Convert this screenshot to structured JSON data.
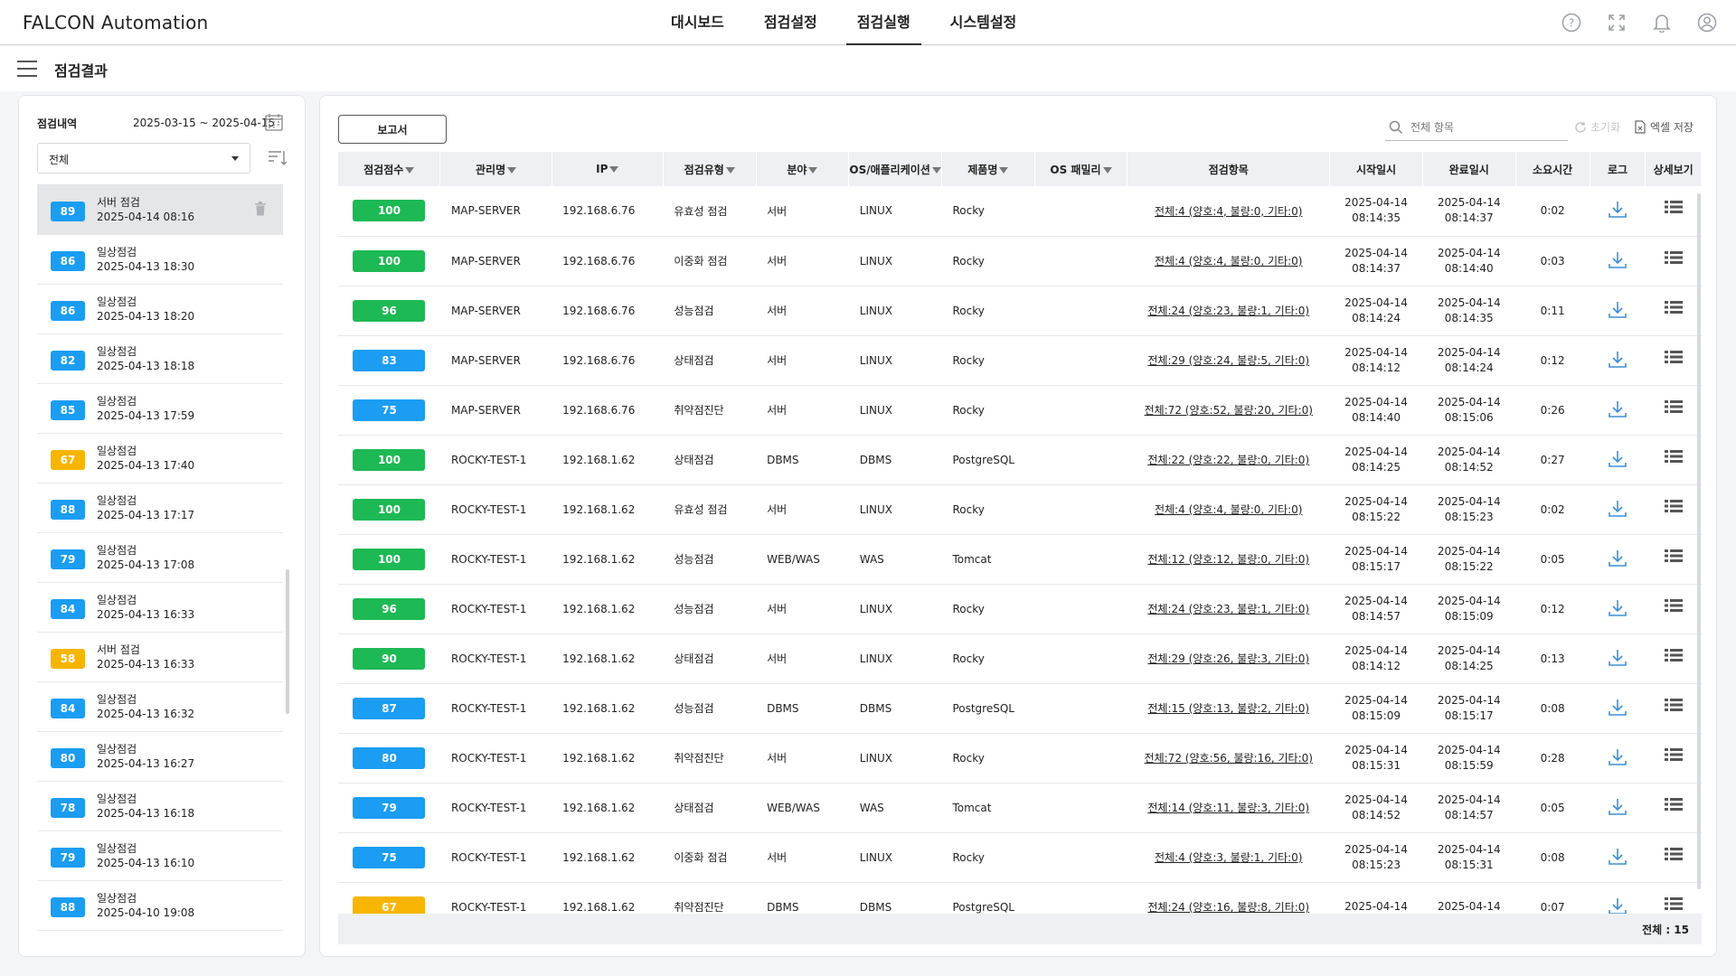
{
  "app_title": "FALCON Automation",
  "nav": [
    "대시보드",
    "점검설정",
    "점검실행",
    "시스템설정"
  ],
  "nav_active": 2,
  "top_icons": [
    "help-icon",
    "fullscreen-icon",
    "bell-icon",
    "user-icon"
  ],
  "page_title": "점검결과",
  "left": {
    "label": "점검내역",
    "date_range": "2025-03-15 ~ 2025-04-15",
    "filter_value": "전체",
    "items": [
      {
        "score": "89",
        "type": "서버 점검",
        "date": "2025-04-14 08:16",
        "color": "#1a9df2",
        "selected": true
      },
      {
        "score": "86",
        "type": "일상점검",
        "date": "2025-04-13 18:30",
        "color": "#1a9df2"
      },
      {
        "score": "86",
        "type": "일상점검",
        "date": "2025-04-13 18:20",
        "color": "#1a9df2"
      },
      {
        "score": "82",
        "type": "일상점검",
        "date": "2025-04-13 18:18",
        "color": "#1a9df2"
      },
      {
        "score": "85",
        "type": "일상점검",
        "date": "2025-04-13 17:59",
        "color": "#1a9df2"
      },
      {
        "score": "67",
        "type": "일상점검",
        "date": "2025-04-13 17:40",
        "color": "#f7b500"
      },
      {
        "score": "88",
        "type": "일상점검",
        "date": "2025-04-13 17:17",
        "color": "#1a9df2"
      },
      {
        "score": "79",
        "type": "일상점검",
        "date": "2025-04-13 17:08",
        "color": "#1a9df2"
      },
      {
        "score": "84",
        "type": "일상점검",
        "date": "2025-04-13 16:33",
        "color": "#1a9df2"
      },
      {
        "score": "58",
        "type": "서버 점검",
        "date": "2025-04-13 16:33",
        "color": "#f7b500"
      },
      {
        "score": "84",
        "type": "일상점검",
        "date": "2025-04-13 16:32",
        "color": "#1a9df2"
      },
      {
        "score": "80",
        "type": "일상점검",
        "date": "2025-04-13 16:27",
        "color": "#1a9df2"
      },
      {
        "score": "78",
        "type": "일상점검",
        "date": "2025-04-13 16:18",
        "color": "#1a9df2"
      },
      {
        "score": "79",
        "type": "일상점검",
        "date": "2025-04-13 16:10",
        "color": "#1a9df2"
      },
      {
        "score": "88",
        "type": "일상점검",
        "date": "2025-04-10 19:08",
        "color": "#1a9df2"
      }
    ]
  },
  "main": {
    "report_button": "보고서",
    "search_placeholder": "전체 항목",
    "reset_label": "초기화",
    "excel_label": "엑셀 저장",
    "columns": [
      "점검점수",
      "관리명",
      "IP",
      "점검유형",
      "분야",
      "OS/애플리케이션",
      "제품명",
      "OS 패밀리",
      "점검항목",
      "시작일시",
      "완료일시",
      "소요시간",
      "로그",
      "상세보기"
    ],
    "filterable": [
      true,
      true,
      true,
      true,
      true,
      true,
      true,
      true,
      false,
      false,
      false,
      false,
      false,
      false
    ],
    "rows": [
      {
        "score": "100",
        "color": "#1db954",
        "name": "MAP-SERVER",
        "ip": "192.168.6.76",
        "type": "유효성 점검",
        "field": "서버",
        "os": "LINUX",
        "product": "Rocky",
        "family": "",
        "items": "전체:4 (양호:4, 불량:0, 기타:0)",
        "start_d": "2025-04-14",
        "start_t": "08:14:35",
        "end_d": "2025-04-14",
        "end_t": "08:14:37",
        "dur": "0:02"
      },
      {
        "score": "100",
        "color": "#1db954",
        "name": "MAP-SERVER",
        "ip": "192.168.6.76",
        "type": "이중화 점검",
        "field": "서버",
        "os": "LINUX",
        "product": "Rocky",
        "family": "",
        "items": "전체:4 (양호:4, 불량:0, 기타:0)",
        "start_d": "2025-04-14",
        "start_t": "08:14:37",
        "end_d": "2025-04-14",
        "end_t": "08:14:40",
        "dur": "0:03"
      },
      {
        "score": "96",
        "color": "#1db954",
        "name": "MAP-SERVER",
        "ip": "192.168.6.76",
        "type": "성능점검",
        "field": "서버",
        "os": "LINUX",
        "product": "Rocky",
        "family": "",
        "items": "전체:24 (양호:23, 불량:1, 기타:0)",
        "start_d": "2025-04-14",
        "start_t": "08:14:24",
        "end_d": "2025-04-14",
        "end_t": "08:14:35",
        "dur": "0:11"
      },
      {
        "score": "83",
        "color": "#1a9df2",
        "name": "MAP-SERVER",
        "ip": "192.168.6.76",
        "type": "상태점검",
        "field": "서버",
        "os": "LINUX",
        "product": "Rocky",
        "family": "",
        "items": "전체:29 (양호:24, 불량:5, 기타:0)",
        "start_d": "2025-04-14",
        "start_t": "08:14:12",
        "end_d": "2025-04-14",
        "end_t": "08:14:24",
        "dur": "0:12"
      },
      {
        "score": "75",
        "color": "#1a9df2",
        "name": "MAP-SERVER",
        "ip": "192.168.6.76",
        "type": "취약점진단",
        "field": "서버",
        "os": "LINUX",
        "product": "Rocky",
        "family": "",
        "items": "전체:72 (양호:52, 불량:20, 기타:0)",
        "start_d": "2025-04-14",
        "start_t": "08:14:40",
        "end_d": "2025-04-14",
        "end_t": "08:15:06",
        "dur": "0:26"
      },
      {
        "score": "100",
        "color": "#1db954",
        "name": "ROCKY-TEST-1",
        "ip": "192.168.1.62",
        "type": "상태점검",
        "field": "DBMS",
        "os": "DBMS",
        "product": "PostgreSQL",
        "family": "",
        "items": "전체:22 (양호:22, 불량:0, 기타:0)",
        "start_d": "2025-04-14",
        "start_t": "08:14:25",
        "end_d": "2025-04-14",
        "end_t": "08:14:52",
        "dur": "0:27"
      },
      {
        "score": "100",
        "color": "#1db954",
        "name": "ROCKY-TEST-1",
        "ip": "192.168.1.62",
        "type": "유효성 점검",
        "field": "서버",
        "os": "LINUX",
        "product": "Rocky",
        "family": "",
        "items": "전체:4 (양호:4, 불량:0, 기타:0)",
        "start_d": "2025-04-14",
        "start_t": "08:15:22",
        "end_d": "2025-04-14",
        "end_t": "08:15:23",
        "dur": "0:02"
      },
      {
        "score": "100",
        "color": "#1db954",
        "name": "ROCKY-TEST-1",
        "ip": "192.168.1.62",
        "type": "성능점검",
        "field": "WEB/WAS",
        "os": "WAS",
        "product": "Tomcat",
        "family": "",
        "items": "전체:12 (양호:12, 불량:0, 기타:0)",
        "start_d": "2025-04-14",
        "start_t": "08:15:17",
        "end_d": "2025-04-14",
        "end_t": "08:15:22",
        "dur": "0:05"
      },
      {
        "score": "96",
        "color": "#1db954",
        "name": "ROCKY-TEST-1",
        "ip": "192.168.1.62",
        "type": "성능점검",
        "field": "서버",
        "os": "LINUX",
        "product": "Rocky",
        "family": "",
        "items": "전체:24 (양호:23, 불량:1, 기타:0)",
        "start_d": "2025-04-14",
        "start_t": "08:14:57",
        "end_d": "2025-04-14",
        "end_t": "08:15:09",
        "dur": "0:12"
      },
      {
        "score": "90",
        "color": "#1db954",
        "name": "ROCKY-TEST-1",
        "ip": "192.168.1.62",
        "type": "상태점검",
        "field": "서버",
        "os": "LINUX",
        "product": "Rocky",
        "family": "",
        "items": "전체:29 (양호:26, 불량:3, 기타:0)",
        "start_d": "2025-04-14",
        "start_t": "08:14:12",
        "end_d": "2025-04-14",
        "end_t": "08:14:25",
        "dur": "0:13"
      },
      {
        "score": "87",
        "color": "#1a9df2",
        "name": "ROCKY-TEST-1",
        "ip": "192.168.1.62",
        "type": "성능점검",
        "field": "DBMS",
        "os": "DBMS",
        "product": "PostgreSQL",
        "family": "",
        "items": "전체:15 (양호:13, 불량:2, 기타:0)",
        "start_d": "2025-04-14",
        "start_t": "08:15:09",
        "end_d": "2025-04-14",
        "end_t": "08:15:17",
        "dur": "0:08"
      },
      {
        "score": "80",
        "color": "#1a9df2",
        "name": "ROCKY-TEST-1",
        "ip": "192.168.1.62",
        "type": "취약점진단",
        "field": "서버",
        "os": "LINUX",
        "product": "Rocky",
        "family": "",
        "items": "전체:72 (양호:56, 불량:16, 기타:0)",
        "start_d": "2025-04-14",
        "start_t": "08:15:31",
        "end_d": "2025-04-14",
        "end_t": "08:15:59",
        "dur": "0:28"
      },
      {
        "score": "79",
        "color": "#1a9df2",
        "name": "ROCKY-TEST-1",
        "ip": "192.168.1.62",
        "type": "상태점검",
        "field": "WEB/WAS",
        "os": "WAS",
        "product": "Tomcat",
        "family": "",
        "items": "전체:14 (양호:11, 불량:3, 기타:0)",
        "start_d": "2025-04-14",
        "start_t": "08:14:52",
        "end_d": "2025-04-14",
        "end_t": "08:14:57",
        "dur": "0:05"
      },
      {
        "score": "75",
        "color": "#1a9df2",
        "name": "ROCKY-TEST-1",
        "ip": "192.168.1.62",
        "type": "이중화 점검",
        "field": "서버",
        "os": "LINUX",
        "product": "Rocky",
        "family": "",
        "items": "전체:4 (양호:3, 불량:1, 기타:0)",
        "start_d": "2025-04-14",
        "start_t": "08:15:23",
        "end_d": "2025-04-14",
        "end_t": "08:15:31",
        "dur": "0:08"
      },
      {
        "score": "67",
        "color": "#f7b500",
        "name": "ROCKY-TEST-1",
        "ip": "192.168.1.62",
        "type": "취약점진단",
        "field": "DBMS",
        "os": "DBMS",
        "product": "PostgreSQL",
        "family": "",
        "items": "전체:24 (양호:16, 불량:8, 기타:0)",
        "start_d": "2025-04-14",
        "start_t": "",
        "end_d": "2025-04-14",
        "end_t": "",
        "dur": "0:07"
      }
    ],
    "total_label": "전체 : 15"
  },
  "colors": {
    "green": "#1db954",
    "blue": "#1a9df2",
    "yellow": "#f7b500"
  }
}
